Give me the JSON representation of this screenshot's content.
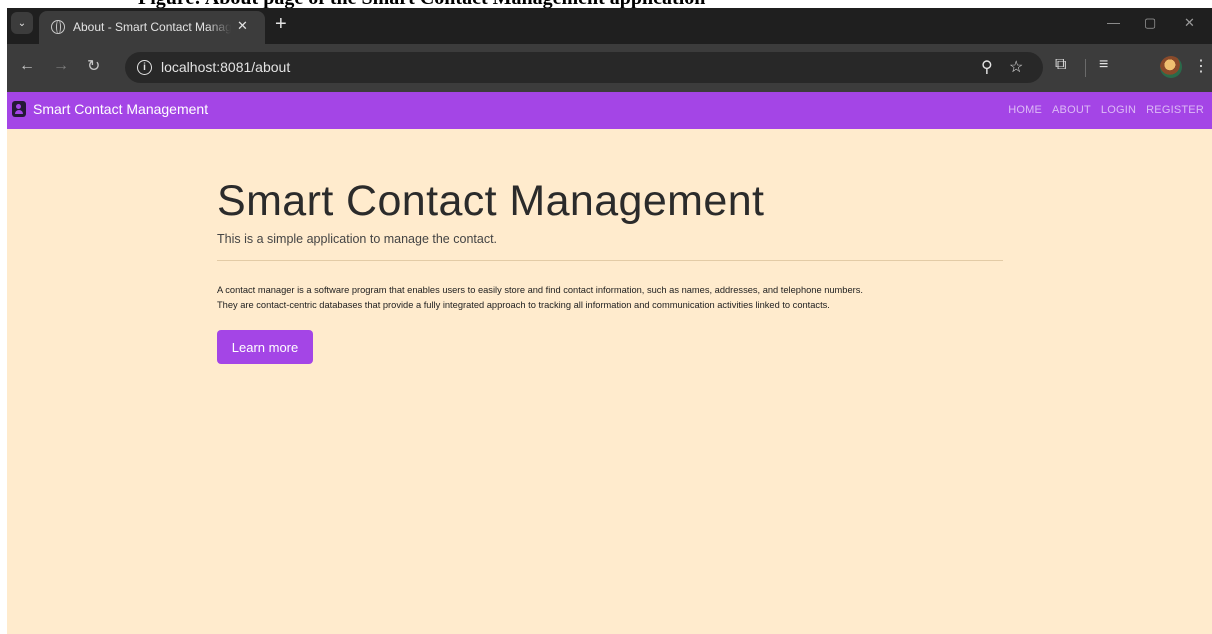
{
  "caption": {
    "text": "Figure: About page of the Smart Contact Management application"
  },
  "browser": {
    "tab": {
      "title": "About - Smart Contact Manager",
      "close_glyph": "✕"
    },
    "new_tab_glyph": "+",
    "window_controls": {
      "minimize": "—",
      "restore": "▢",
      "close": "✕"
    },
    "address": {
      "url": "localhost:8081/about"
    },
    "icons": {
      "back": "arrow-left-icon",
      "forward": "arrow-right-icon",
      "reload": "reload-icon",
      "info": "info-icon",
      "zoom": "zoom-icon",
      "star": "bookmark-star-icon",
      "extensions": "extensions-icon",
      "media": "media-controls-icon",
      "menu": "kebab-menu-icon"
    }
  },
  "navbar": {
    "brand": "Smart Contact Management",
    "links": [
      "HOME",
      "ABOUT",
      "LOGIN",
      "REGISTER"
    ],
    "color": "#a445e6"
  },
  "hero": {
    "title": "Smart Contact Management",
    "lead": "This is a simple application to manage the contact.",
    "body_lines": [
      "A contact manager is a software program that enables users to easily store and find contact information, such as names, addresses, and telephone numbers.",
      "They are contact-centric databases that provide a fully integrated approach to tracking all information and communication activities linked to contacts."
    ],
    "button_label": "Learn more"
  },
  "colors": {
    "page_background": "#ffebcd",
    "accent": "#a445e6",
    "browser_dark": "#1f1f1f"
  }
}
